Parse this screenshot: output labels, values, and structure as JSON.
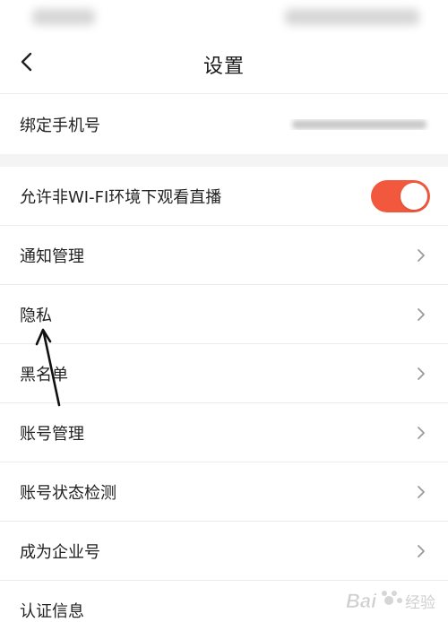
{
  "header": {
    "title": "设置",
    "back_icon": "chevron-left-icon"
  },
  "settings": {
    "bind_phone_label": "绑定手机号",
    "wifi_live_label": "允许非WI-FI环境下观看直播",
    "wifi_live_enabled": true,
    "items": [
      {
        "label": "通知管理"
      },
      {
        "label": "隐私"
      },
      {
        "label": "黑名单"
      },
      {
        "label": "账号管理"
      },
      {
        "label": "账号状态检测"
      },
      {
        "label": "成为企业号"
      },
      {
        "label": "认证信息"
      }
    ]
  },
  "watermark": {
    "text": "Bai 经验"
  },
  "colors": {
    "toggle_on": "#f2583e",
    "divider": "#ececec",
    "band": "#f4f4f4"
  }
}
